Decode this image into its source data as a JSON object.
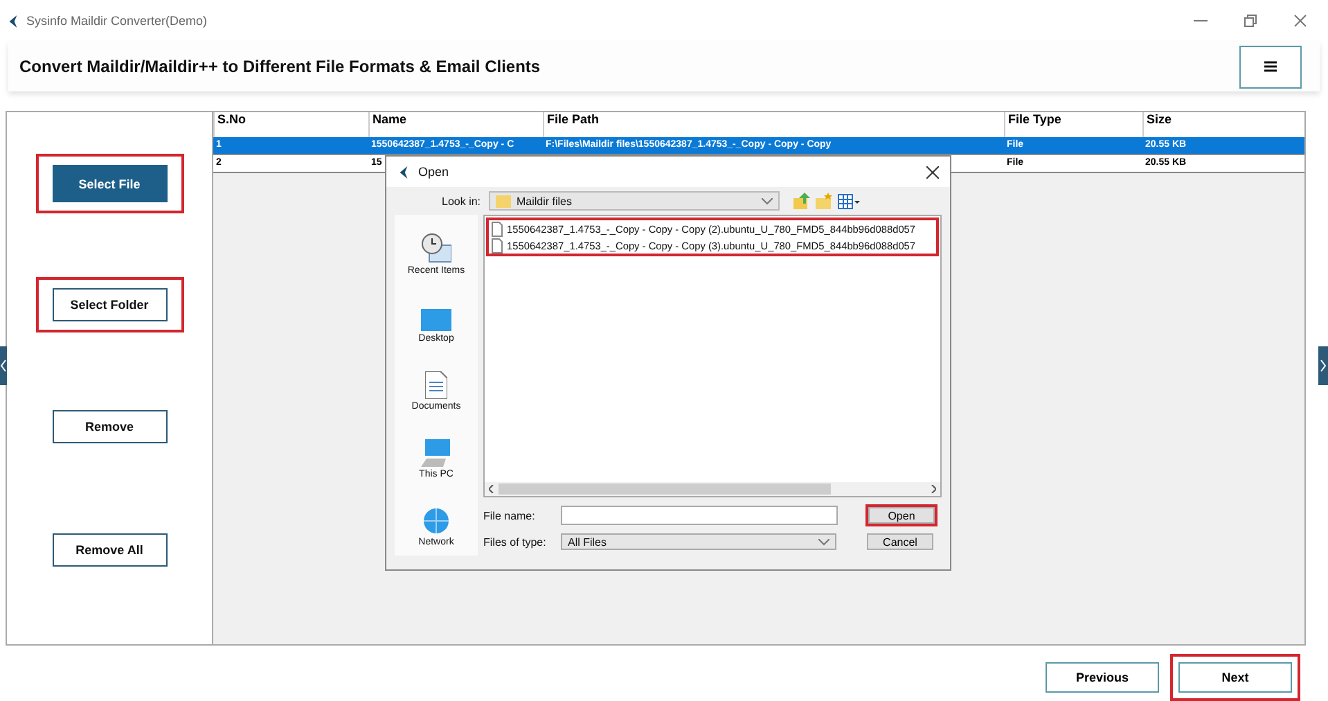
{
  "window": {
    "title": "Sysinfo Maildir Converter(Demo)"
  },
  "header": {
    "title": "Convert Maildir/Maildir++ to Different File Formats & Email Clients"
  },
  "side_buttons": [
    {
      "label": "Select File",
      "kind": "primary",
      "highlighted": true
    },
    {
      "label": "Select Folder",
      "kind": "plain",
      "highlighted": true
    },
    {
      "label": "Remove",
      "kind": "plain",
      "highlighted": false
    },
    {
      "label": "Remove All",
      "kind": "plain",
      "highlighted": false
    }
  ],
  "table": {
    "columns": [
      "S.No",
      "Name",
      "File Path",
      "File Type",
      "Size"
    ],
    "rows": [
      {
        "selected": true,
        "cells": [
          "1",
          "1550642387_1.4753_-_Copy - C",
          "F:\\Files\\Maildir files\\1550642387_1.4753_-_Copy - Copy - Copy",
          "File",
          "20.55 KB"
        ]
      },
      {
        "selected": false,
        "cells": [
          "2",
          "15",
          "",
          "File",
          "20.55 KB"
        ]
      }
    ]
  },
  "dialog": {
    "title": "Open",
    "look_in_label": "Look in:",
    "look_in_value": "Maildir files",
    "places": [
      "Recent Items",
      "Desktop",
      "Documents",
      "This PC",
      "Network"
    ],
    "files": [
      {
        "name": "1550642387_1.4753_-_Copy - Copy - Copy (2).ubuntu_U_780_FMD5_844bb96d088d057"
      },
      {
        "name": "1550642387_1.4753_-_Copy - Copy - Copy (3).ubuntu_U_780_FMD5_844bb96d088d057"
      }
    ],
    "files_highlighted": true,
    "file_name_label": "File name:",
    "files_of_type_label": "Files of type:",
    "files_of_type_value": "All Files",
    "buttons": [
      {
        "label": "Open",
        "highlighted": true
      },
      {
        "label": "Cancel",
        "highlighted": false
      }
    ]
  },
  "footer_buttons": [
    {
      "label": "Previous",
      "highlighted": false
    },
    {
      "label": "Next",
      "highlighted": true
    }
  ]
}
